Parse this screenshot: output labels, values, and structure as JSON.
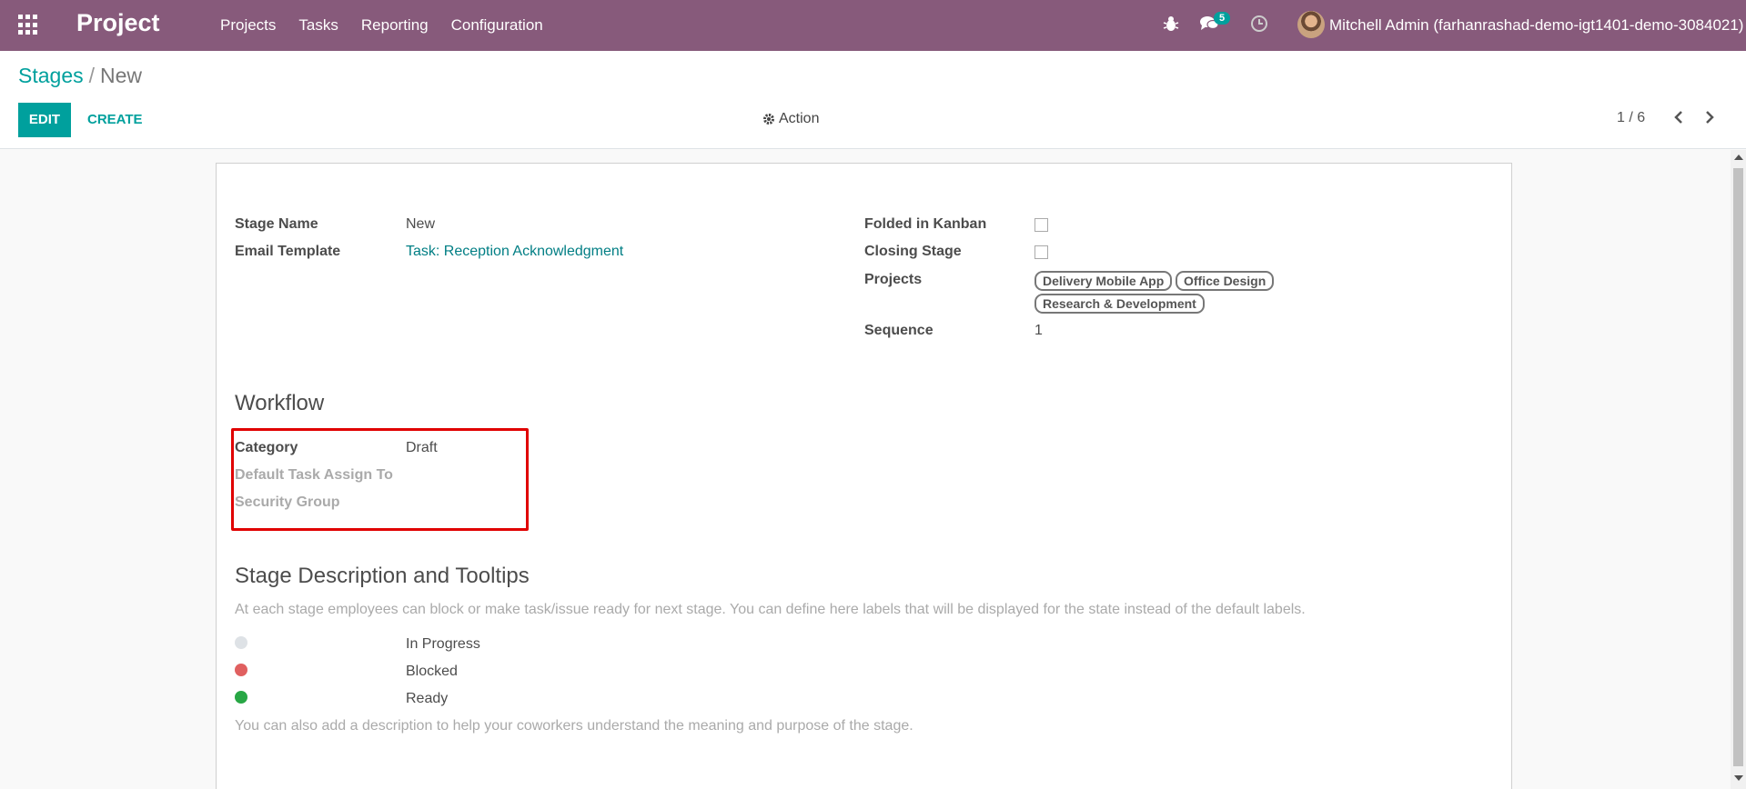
{
  "navbar": {
    "brand": "Project",
    "menu": [
      "Projects",
      "Tasks",
      "Reporting",
      "Configuration"
    ],
    "chat_count": "5",
    "user": "Mitchell Admin (farhanrashad-demo-igt1401-demo-3084021)"
  },
  "control": {
    "breadcrumb_parent": "Stages",
    "breadcrumb_sep": "/",
    "breadcrumb_current": "New",
    "edit_label": "EDIT",
    "create_label": "CREATE",
    "action_label": "Action",
    "pager": "1 / 6"
  },
  "form": {
    "stage_name_label": "Stage Name",
    "stage_name_value": "New",
    "email_template_label": "Email Template",
    "email_template_value": "Task: Reception Acknowledgment",
    "folded_label": "Folded in Kanban",
    "folded_checked": false,
    "closing_label": "Closing Stage",
    "closing_checked": false,
    "projects_label": "Projects",
    "projects": [
      "Delivery Mobile App",
      "Office Design",
      "Research & Development"
    ],
    "sequence_label": "Sequence",
    "sequence_value": "1",
    "workflow_title": "Workflow",
    "category_label": "Category",
    "category_value": "Draft",
    "default_assign_label": "Default Task Assign To",
    "security_group_label": "Security Group",
    "desc_title": "Stage Description and Tooltips",
    "desc_help": "At each stage employees can block or make task/issue ready for next stage. You can define here labels that will be displayed for the state instead of the default labels.",
    "states": [
      {
        "label": "In Progress",
        "color": "#dee2e6"
      },
      {
        "label": "Blocked",
        "color": "#e06060"
      },
      {
        "label": "Ready",
        "color": "#28a745"
      }
    ],
    "desc_footer": "You can also add a description to help your coworkers understand the meaning and purpose of the stage."
  },
  "colors": {
    "brand": "#875a7b",
    "accent": "#00a09d",
    "highlight": "#e00000"
  }
}
